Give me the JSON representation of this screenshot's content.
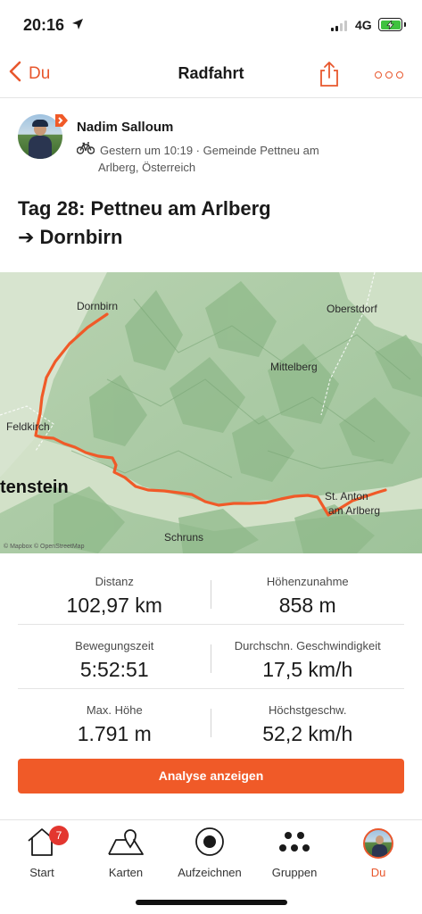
{
  "status_bar": {
    "time": "20:16",
    "network": "4G",
    "location_icon": "location-arrow-icon",
    "battery_icon": "battery-charging-icon"
  },
  "nav": {
    "back_label": "Du",
    "title": "Radfahrt",
    "share_icon": "share-icon",
    "more_icon": "more-dots-icon",
    "accent_color": "#e8572d"
  },
  "athlete": {
    "name": "Nadim Salloum",
    "meta_line1": "Gestern um 10:19 · Gemeinde Pettneu am",
    "meta_line2": "Arlberg, Österreich",
    "activity_icon": "bicycle-icon"
  },
  "activity": {
    "title_line1": "Tag 28: Pettneu am Arlberg",
    "title_line2": "➔ Dornbirn"
  },
  "map": {
    "labels": {
      "dornbirn": "Dornbirn",
      "oberstdorf": "Oberstdorf",
      "mittelberg": "Mittelberg",
      "feldkirch": "Feldkirch",
      "liechtenstein": "tenstein",
      "st_anton_1": "St. Anton",
      "st_anton_2": "am Arlberg",
      "schruns": "Schruns"
    },
    "attribution": "© Mapbox © OpenStreetMap",
    "route_color": "#f05a28"
  },
  "stats": [
    [
      {
        "label": "Distanz",
        "value": "102,97 km"
      },
      {
        "label": "Höhenzunahme",
        "value": "858 m"
      }
    ],
    [
      {
        "label": "Bewegungszeit",
        "value": "5:52:51"
      },
      {
        "label": "Durchschn. Geschwindigkeit",
        "value": "17,5 km/h"
      }
    ],
    [
      {
        "label": "Max. Höhe",
        "value": "1.791 m"
      },
      {
        "label": "Höchstgeschw.",
        "value": "52,2 km/h"
      }
    ]
  ],
  "analyse_button": "Analyse anzeigen",
  "tabs": [
    {
      "label": "Start",
      "icon": "home-icon",
      "badge": "7"
    },
    {
      "label": "Karten",
      "icon": "map-pin-icon"
    },
    {
      "label": "Aufzeichnen",
      "icon": "record-icon"
    },
    {
      "label": "Gruppen",
      "icon": "groups-icon"
    },
    {
      "label": "Du",
      "icon": "profile-avatar-icon",
      "active": true
    }
  ]
}
